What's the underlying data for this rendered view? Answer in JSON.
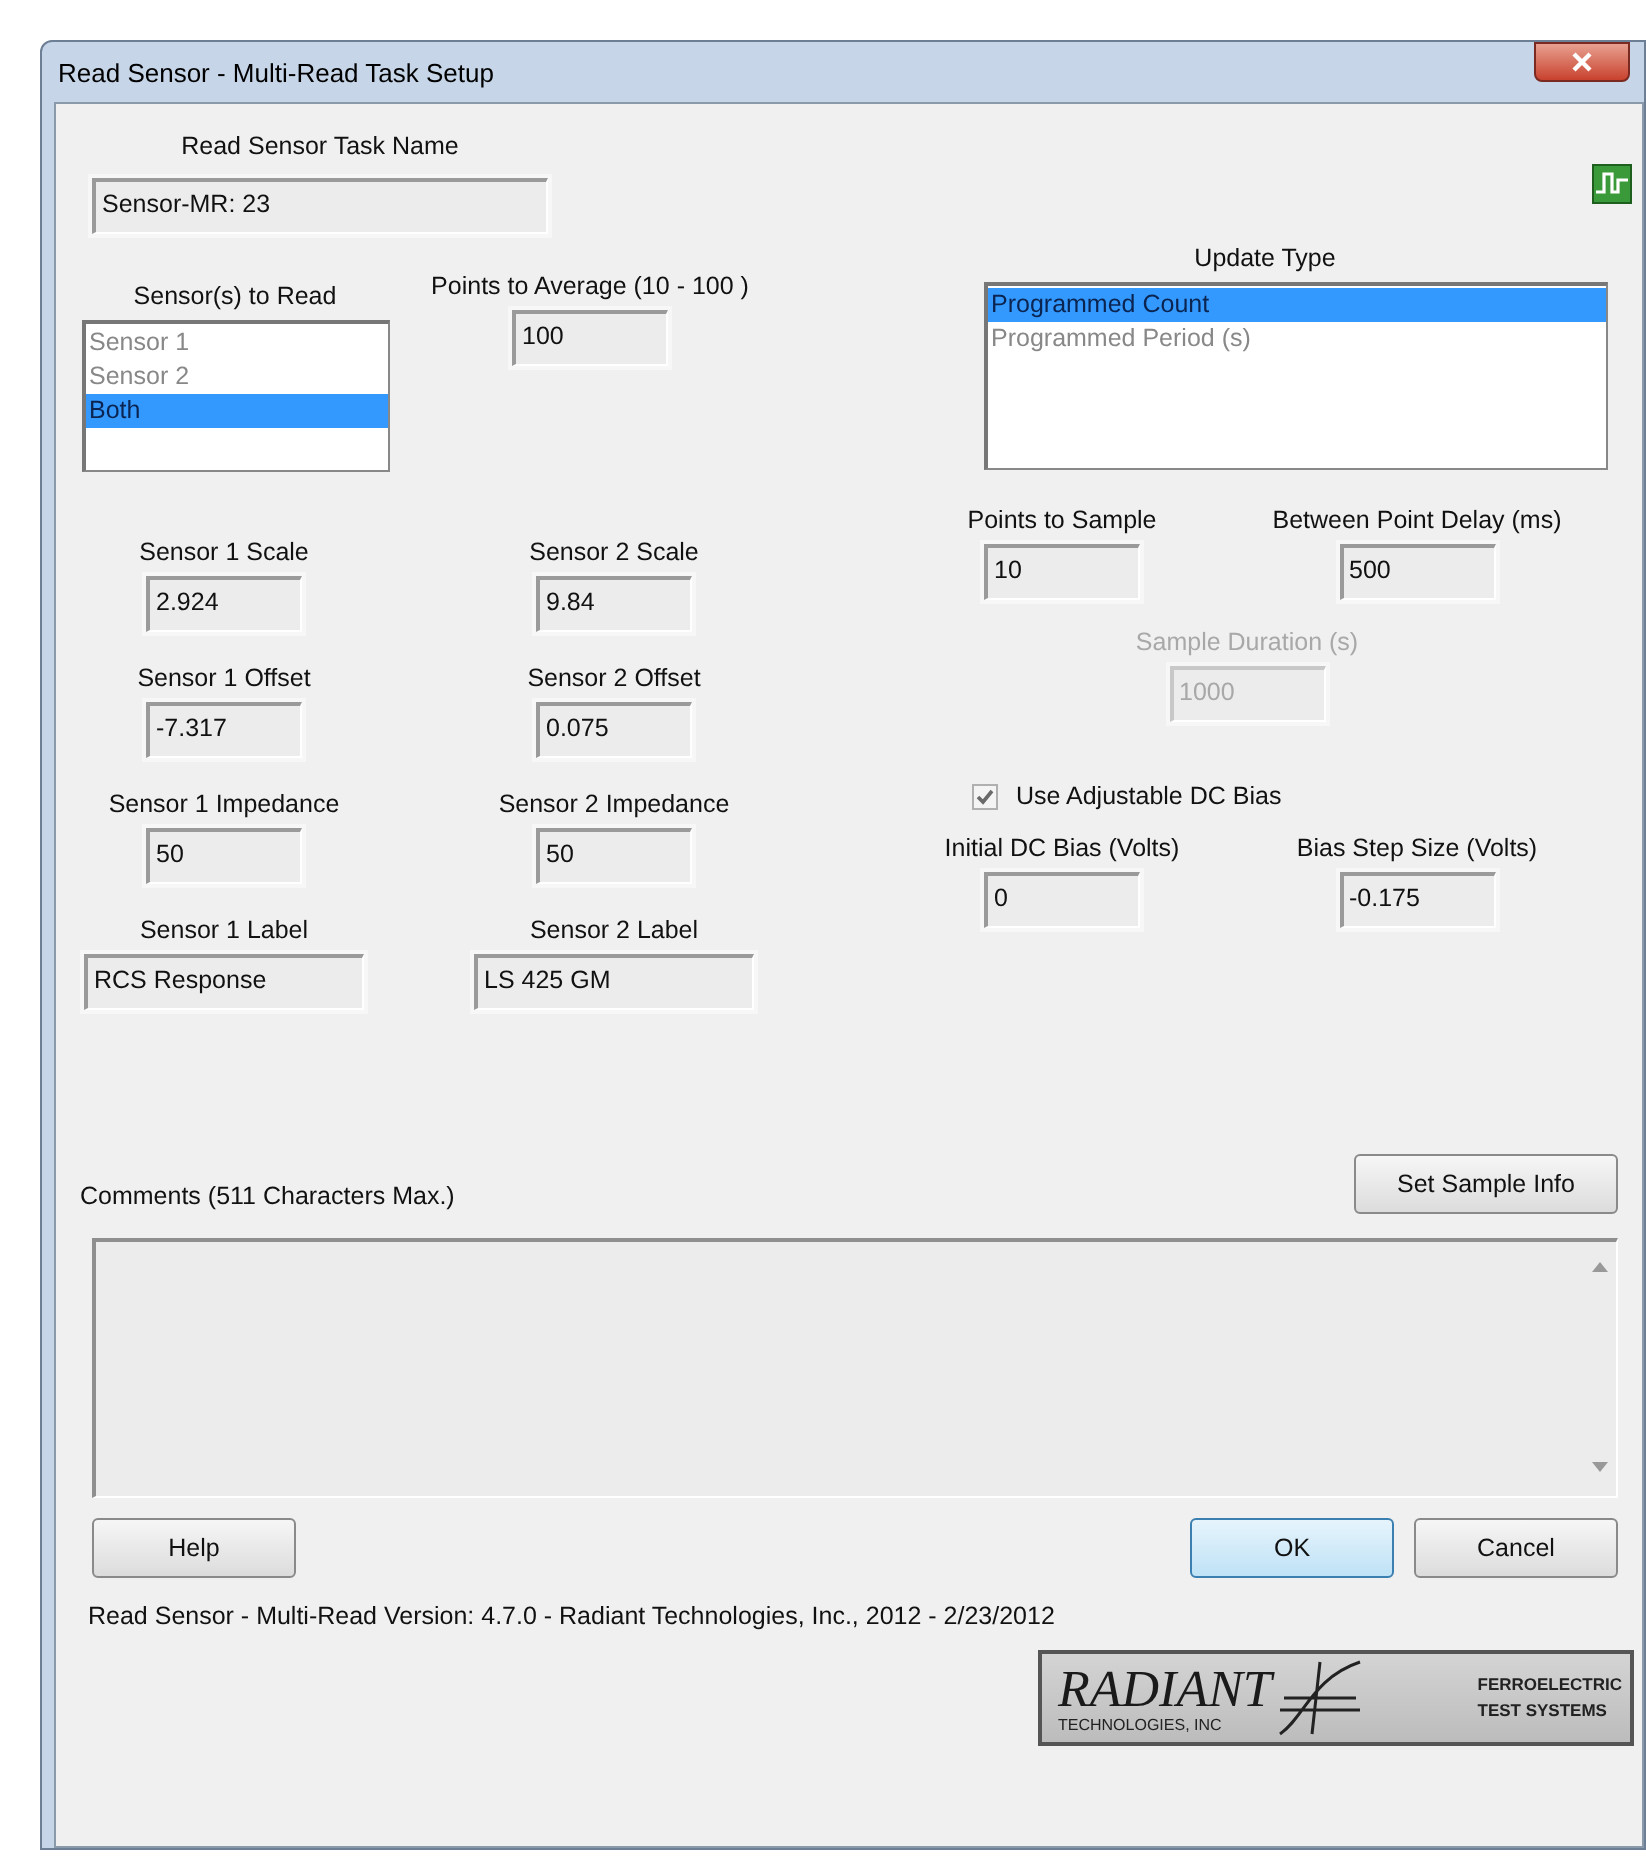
{
  "window": {
    "title": "Read Sensor - Multi-Read Task Setup"
  },
  "task_name": {
    "label": "Read Sensor Task Name",
    "value": "Sensor-MR: 23"
  },
  "sensors_to_read": {
    "label": "Sensor(s) to Read",
    "items": [
      {
        "label": "Sensor 1",
        "selected": false
      },
      {
        "label": "Sensor 2",
        "selected": false
      },
      {
        "label": "Both",
        "selected": true
      }
    ]
  },
  "points_to_average": {
    "label": "Points to Average (10 - 100 )",
    "value": "100"
  },
  "sensor_fields": [
    {
      "label": "Sensor 1 Scale",
      "value": "2.924",
      "kind": "number"
    },
    {
      "label": "Sensor 2 Scale",
      "value": "9.84",
      "kind": "number"
    },
    {
      "label": "Sensor 1 Offset",
      "value": "-7.317",
      "kind": "number"
    },
    {
      "label": "Sensor 2 Offset",
      "value": "0.075",
      "kind": "number"
    },
    {
      "label": "Sensor 1 Impedance",
      "value": "50",
      "kind": "number"
    },
    {
      "label": "Sensor 2 Impedance",
      "value": "50",
      "kind": "number"
    },
    {
      "label": "Sensor 1 Label",
      "value": "RCS Response",
      "kind": "text"
    },
    {
      "label": "Sensor 2 Label",
      "value": "LS 425 GM",
      "kind": "text"
    }
  ],
  "update_type": {
    "label": "Update Type",
    "items": [
      {
        "label": "Programmed Count",
        "selected": true
      },
      {
        "label": "Programmed Period (s)",
        "selected": false
      }
    ]
  },
  "sampling_fields": [
    {
      "label": "Points to Sample",
      "value": "10",
      "disabled": false
    },
    {
      "label": "Between Point Delay (ms)",
      "value": "500",
      "disabled": false
    },
    {
      "label": "Sample Duration (s)",
      "value": "1000",
      "disabled": true
    }
  ],
  "dc_bias": {
    "checkbox": {
      "label": "Use Adjustable DC Bias",
      "checked": true,
      "disabled": true
    },
    "fields": [
      {
        "label": "Initial DC Bias (Volts)",
        "value": "0"
      },
      {
        "label": "Bias Step Size (Volts)",
        "value": "-0.175"
      }
    ]
  },
  "comments": {
    "label": "Comments (511 Characters Max.)"
  },
  "set_sample_info_button": {
    "label": "Set Sample Info"
  },
  "help_button": {
    "label": "Help"
  },
  "ok_button": {
    "label": "OK",
    "default": true
  },
  "cancel_button": {
    "label": "Cancel",
    "default": false
  },
  "version_text": "Read Sensor - Multi-Read Version: 4.7.0 - Radiant Technologies, Inc., 2012 - 2/23/2012",
  "logo": {
    "name": "RADIANT",
    "subtitle": "TECHNOLOGIES, INC",
    "tagline": [
      "FERROELECTRIC",
      "TEST SYSTEMS"
    ]
  }
}
